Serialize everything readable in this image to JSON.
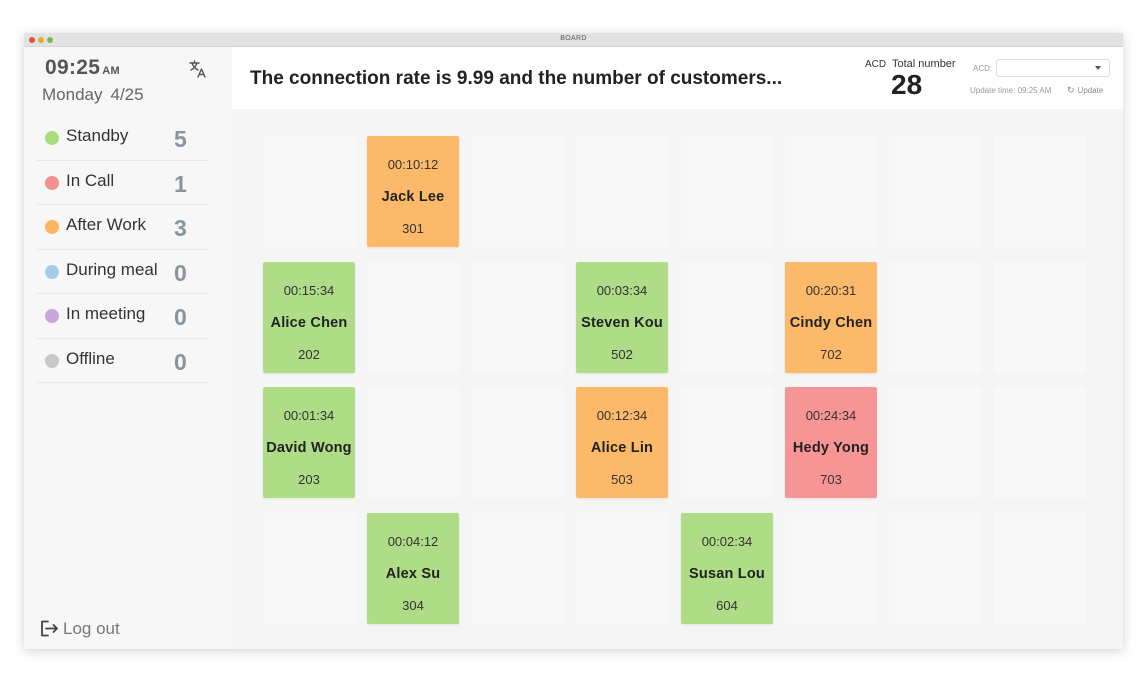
{
  "window": {
    "title": "BOARD"
  },
  "sidebar": {
    "time": "09:25",
    "ampm": "AM",
    "weekday": "Monday",
    "date": "4/25",
    "translate_icon": "translate-icon",
    "statuses": [
      {
        "label": "Standby",
        "count": "5",
        "color": "#a8dc80"
      },
      {
        "label": "In Call",
        "count": "1",
        "color": "#f49090"
      },
      {
        "label": "After Work",
        "count": "3",
        "color": "#fcb462"
      },
      {
        "label": "During meal",
        "count": "0",
        "color": "#a4cfe3"
      },
      {
        "label": "In meeting",
        "count": "0",
        "color": "#c8a8d8"
      },
      {
        "label": "Offline",
        "count": "0",
        "color": "#c8c8c8"
      }
    ],
    "logout_label": "Log out"
  },
  "header": {
    "headline": "The connection rate is 9.99 and the number of customers...",
    "acd_label": "ACD",
    "total_label": "Total number",
    "total_number": "28",
    "acd_select_label": "ACD:",
    "acd_select_value": "",
    "update_time_label": "Update time: 09:25 AM",
    "update_button_label": "Update"
  },
  "colors": {
    "standby": "#afdc86",
    "in_call": "#f79596",
    "after_work": "#fdb96a",
    "empty": "#f8f8f8"
  },
  "grid": {
    "columns": 8,
    "rows": 4,
    "seats": [
      {
        "row": 0,
        "col": 1,
        "status": "after_work",
        "timer": "00:10:12",
        "name": "Jack Lee",
        "ext": "301"
      },
      {
        "row": 1,
        "col": 0,
        "status": "standby",
        "timer": "00:15:34",
        "name": "Alice Chen",
        "ext": "202"
      },
      {
        "row": 1,
        "col": 3,
        "status": "standby",
        "timer": "00:03:34",
        "name": "Steven Kou",
        "ext": "502"
      },
      {
        "row": 1,
        "col": 5,
        "status": "after_work",
        "timer": "00:20:31",
        "name": "Cindy Chen",
        "ext": "702"
      },
      {
        "row": 2,
        "col": 0,
        "status": "standby",
        "timer": "00:01:34",
        "name": "David Wong",
        "ext": "203"
      },
      {
        "row": 2,
        "col": 3,
        "status": "after_work",
        "timer": "00:12:34",
        "name": "Alice Lin",
        "ext": "503"
      },
      {
        "row": 2,
        "col": 5,
        "status": "in_call",
        "timer": "00:24:34",
        "name": "Hedy Yong",
        "ext": "703"
      },
      {
        "row": 3,
        "col": 1,
        "status": "standby",
        "timer": "00:04:12",
        "name": "Alex Su",
        "ext": "304"
      },
      {
        "row": 3,
        "col": 4,
        "status": "standby",
        "timer": "00:02:34",
        "name": "Susan Lou",
        "ext": "604"
      }
    ]
  }
}
